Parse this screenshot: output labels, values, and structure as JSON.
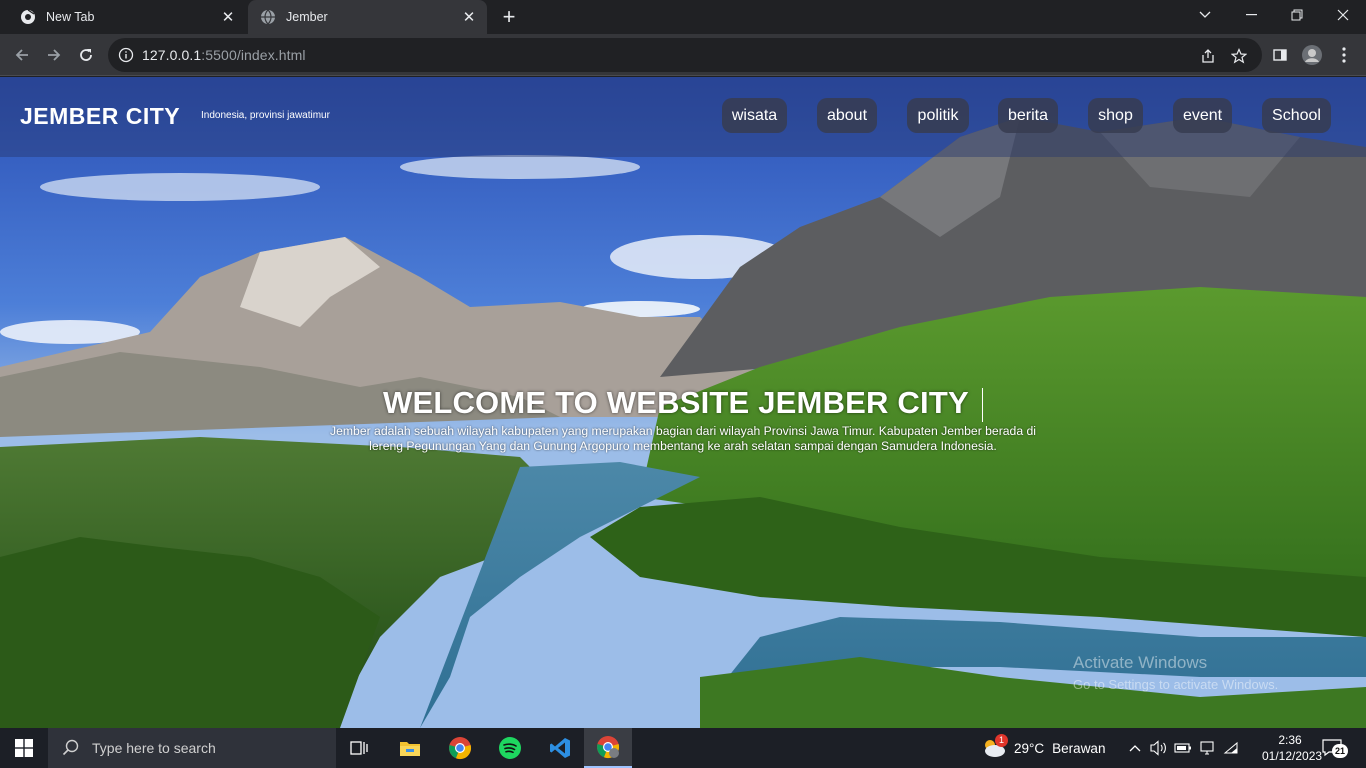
{
  "browser": {
    "tabs": [
      {
        "title": "New Tab",
        "active": false
      },
      {
        "title": "Jember",
        "active": true
      }
    ],
    "url_host": "127.0.0.1",
    "url_rest": ":5500/index.html"
  },
  "page": {
    "brand": "JEMBER CITY",
    "tagline": "Indonesia, provinsi jawatimur",
    "nav": [
      "wisata",
      "about",
      "politik",
      "berita",
      "shop",
      "event",
      "School"
    ],
    "hero_title": "WELCOME TO WEBSITE JEMBER CITY",
    "hero_text_1": "Jember adalah sebuah wilayah kabupaten yang merupakan bagian dari wilayah Provinsi Jawa Timur. Kabupaten Jember berada di",
    "hero_text_2": "lereng Pegunungan Yang dan Gunung Argopuro membentang ke arah selatan sampai dengan Samudera Indonesia.",
    "watermark_title": "Activate Windows",
    "watermark_sub": "Go to Settings to activate Windows."
  },
  "taskbar": {
    "search_placeholder": "Type here to search",
    "weather_temp": "29°C",
    "weather_desc": "Berawan",
    "weather_badge": "1",
    "time": "2:36",
    "date": "01/12/2023",
    "notification_count": "21",
    "apps": [
      "task-view",
      "file-explorer",
      "chrome",
      "spotify",
      "vscode",
      "chrome-profile"
    ]
  },
  "colors": {
    "chrome_dark": "#202124",
    "chrome_toolbar": "#35363a",
    "header_overlay": "#28376e",
    "nav_pill": "#373c50",
    "taskbar": "#1c1f26"
  }
}
